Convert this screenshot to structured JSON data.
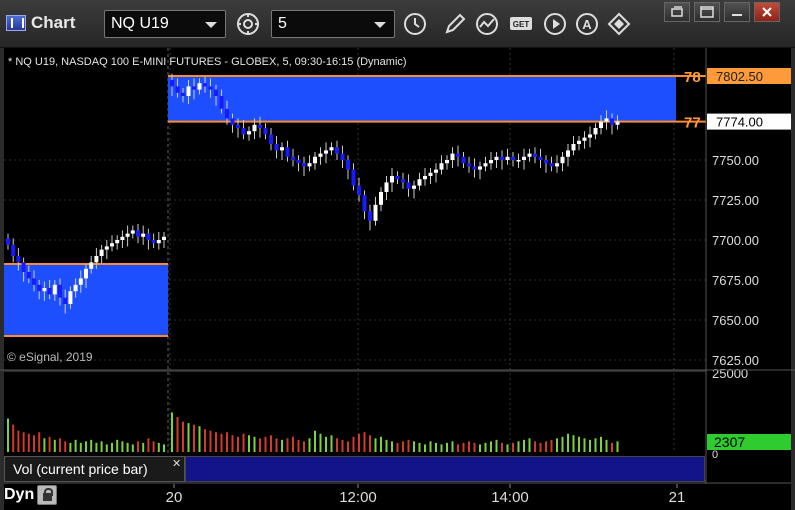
{
  "window": {
    "title": "Chart",
    "symbol": "NQ U19",
    "interval": "5",
    "toolbar_icons": [
      "study-icon",
      "clock-icon",
      "pencil-icon",
      "line-trend-icon",
      "get-icon",
      "play-icon",
      "alert-icon",
      "swap-icon"
    ],
    "window_controls": [
      "restore-icon",
      "maximize-icon",
      "close-icon"
    ]
  },
  "chart": {
    "header": "* NQ U19, NASDAQ 100 E-MINI FUTURES - GLOBEX, 5, 09:30-16:15 (Dynamic)",
    "copyright": "© eSignal, 2019",
    "price_marker_top": "78",
    "price_marker_mid": "77",
    "price_box_top": "7802.50",
    "price_box_current": "7774.00",
    "volume_label": "Vol (current price bar)",
    "volume_value": "2307",
    "volume_axis_top": "25000",
    "volume_axis_bottom": "0",
    "dyn_label": "Dyn",
    "colors": {
      "background": "#000000",
      "zone_fill": "#1e4fff",
      "zone_line": "#ff8c2a",
      "candle_up": "#ffffff",
      "candle_down": "#1a1aff",
      "volume_up": "#7cd33a",
      "volume_down": "#d23a2a",
      "current_price_box": "#ffffff",
      "volume_value_box": "#2ecc2e"
    }
  },
  "chart_data": [
    {
      "type": "candlestick",
      "title": "* NQ U19, NASDAQ 100 E-MINI FUTURES - GLOBEX, 5, 09:30-16:15 (Dynamic)",
      "x_ticks": [
        "20",
        "12:00",
        "14:00",
        "21"
      ],
      "y_ticks": [
        7625,
        7650,
        7675,
        7700,
        7725,
        7750,
        7774,
        7802.5
      ],
      "ylim": [
        7620,
        7815
      ],
      "zones": [
        {
          "low": 7640,
          "high": 7685,
          "session": "prior"
        },
        {
          "low": 7774,
          "high": 7802.5,
          "session": "current"
        }
      ],
      "close_series": [
        7697,
        7690,
        7686,
        7680,
        7676,
        7672,
        7668,
        7670,
        7666,
        7672,
        7664,
        7660,
        7668,
        7672,
        7676,
        7682,
        7686,
        7690,
        7694,
        7696,
        7698,
        7700,
        7702,
        7704,
        7706,
        7702,
        7704,
        7700,
        7698,
        7700,
        7702,
        7796,
        7792,
        7790,
        7796,
        7794,
        7798,
        7796,
        7794,
        7790,
        7782,
        7776,
        7772,
        7770,
        7766,
        7768,
        7772,
        7770,
        7766,
        7760,
        7756,
        7758,
        7752,
        7750,
        7748,
        7746,
        7748,
        7752,
        7754,
        7756,
        7758,
        7754,
        7750,
        7744,
        7734,
        7728,
        7718,
        7712,
        7722,
        7730,
        7736,
        7740,
        7738,
        7736,
        7732,
        7734,
        7738,
        7740,
        7742,
        7744,
        7748,
        7750,
        7754,
        7752,
        7748,
        7746,
        7744,
        7746,
        7748,
        7750,
        7752,
        7750,
        7752,
        7750,
        7750,
        7752,
        7754,
        7752,
        7750,
        7748,
        7746,
        7748,
        7752,
        7756,
        7760,
        7762,
        7764,
        7766,
        7770,
        7774,
        7776,
        7772,
        7774
      ],
      "volume_series_percent": [
        44,
        36,
        28,
        26,
        24,
        22,
        26,
        18,
        20,
        16,
        18,
        14,
        12,
        16,
        12,
        14,
        16,
        12,
        14,
        10,
        12,
        16,
        14,
        12,
        10,
        14,
        12,
        18,
        14,
        12,
        10,
        52,
        46,
        40,
        38,
        36,
        34,
        30,
        28,
        26,
        24,
        26,
        22,
        20,
        24,
        22,
        20,
        18,
        20,
        22,
        18,
        16,
        18,
        20,
        16,
        14,
        18,
        28,
        24,
        20,
        22,
        18,
        16,
        14,
        20,
        24,
        26,
        22,
        18,
        20,
        16,
        14,
        12,
        14,
        16,
        14,
        12,
        10,
        14,
        12,
        10,
        12,
        14,
        10,
        12,
        14,
        12,
        10,
        12,
        14,
        16,
        12,
        10,
        12,
        14,
        16,
        18,
        14,
        12,
        14,
        16,
        18,
        20,
        24,
        22,
        20,
        18,
        16,
        18,
        20,
        16,
        12,
        14
      ]
    }
  ]
}
